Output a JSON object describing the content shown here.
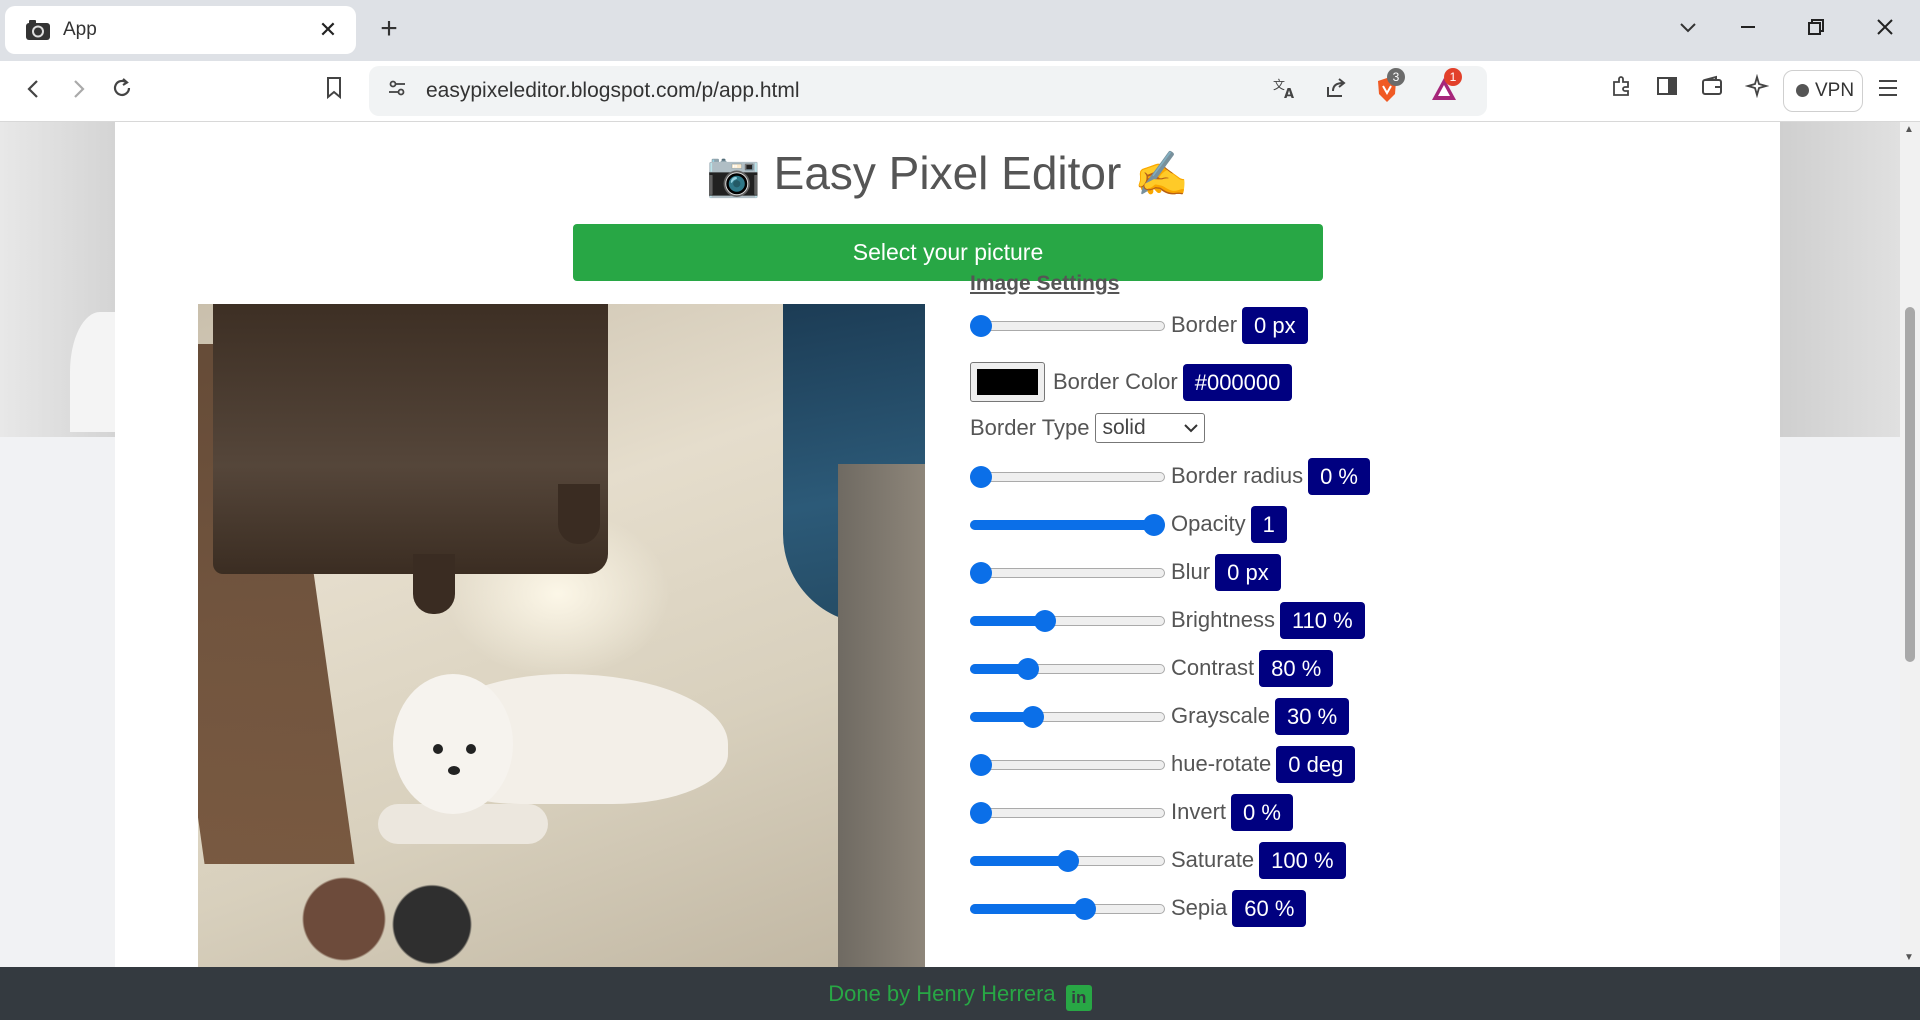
{
  "browser": {
    "tab_title": "App",
    "tab_close": "✕",
    "new_tab": "+",
    "url": "easypixeleditor.blogspot.com/p/app.html",
    "brave_badge": "3",
    "rewards_badge": "1",
    "vpn_label": "VPN"
  },
  "app": {
    "title": "Easy Pixel Editor",
    "title_emoji_left": "📷",
    "title_emoji_right": "✍️",
    "select_button": "Select your picture"
  },
  "settings": {
    "heading": "Image Settings",
    "border": {
      "label": "Border",
      "value": "0 px",
      "fraction": 0
    },
    "border_color": {
      "label": "Border Color",
      "value": "#000000",
      "swatch": "#000000"
    },
    "border_type": {
      "label": "Border Type",
      "selected": "solid"
    },
    "border_radius": {
      "label": "Border radius",
      "value": "0 %",
      "fraction": 0
    },
    "opacity": {
      "label": "Opacity",
      "value": "1",
      "fraction": 1
    },
    "blur": {
      "label": "Blur",
      "value": "0 px",
      "fraction": 0
    },
    "brightness": {
      "label": "Brightness",
      "value": "110 %",
      "fraction": 0.37
    },
    "contrast": {
      "label": "Contrast",
      "value": "80 %",
      "fraction": 0.27
    },
    "grayscale": {
      "label": "Grayscale",
      "value": "30 %",
      "fraction": 0.3
    },
    "hue_rotate": {
      "label": "hue-rotate",
      "value": "0 deg",
      "fraction": 0
    },
    "invert": {
      "label": "Invert",
      "value": "0 %",
      "fraction": 0
    },
    "saturate": {
      "label": "Saturate",
      "value": "100 %",
      "fraction": 0.5
    },
    "sepia": {
      "label": "Sepia",
      "value": "60 %",
      "fraction": 0.6
    }
  },
  "footer": {
    "text": "Done by Henry Herrera",
    "icon": "linkedin-icon",
    "icon_glyph": "in"
  },
  "colors": {
    "accent_green": "#28a745",
    "badge_navy": "#000080",
    "slider_blue": "#0b6fe8"
  }
}
